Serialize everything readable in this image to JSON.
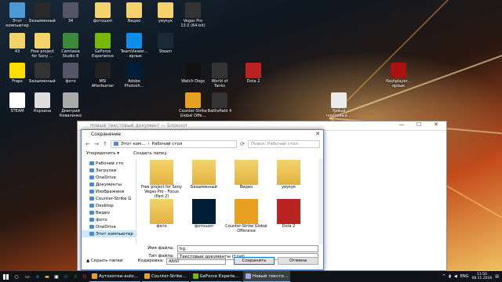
{
  "desktop": {
    "icons": [
      {
        "label": "Этот компьютер",
        "color": "#4a9ad8"
      },
      {
        "label": "Безымянный",
        "color": "#2a2a2a"
      },
      {
        "label": "34",
        "color": "#556"
      },
      {
        "label": "фотошоп",
        "color": "#f4d36b"
      },
      {
        "label": "Видео",
        "color": "#f4d36b"
      },
      {
        "label": "уеукук",
        "color": "#f4d36b"
      },
      {
        "label": "Vegas Pro 13.0 (64-bit)",
        "color": "#333"
      },
      {
        "label": "43",
        "color": "#f4d36b"
      },
      {
        "label": "Free project for Sony ...",
        "color": "#f4d36b"
      },
      {
        "label": "Camtasia Studio 8",
        "color": "#3a8a3a"
      },
      {
        "label": "GeForce Experience",
        "color": "#76b900"
      },
      {
        "label": "TeamViewer... - ярлык",
        "color": "#0e8ee9"
      },
      {
        "label": "Steam",
        "color": "#1b2838"
      },
      {
        "label": "Fraps",
        "color": "#ffdd00"
      },
      {
        "label": "Безымянный",
        "color": "#333"
      },
      {
        "label": "фото",
        "color": "#556"
      },
      {
        "label": "MSI Afterburner",
        "color": "#222"
      },
      {
        "label": "Adobe Photosh...",
        "color": "#001e36"
      },
      {
        "label": "Watch Dogs",
        "color": "#111"
      },
      {
        "label": "World of Tanks",
        "color": "#333"
      },
      {
        "label": "Dota 2",
        "color": "#b22"
      },
      {
        "label": "flashplayer... ярлык",
        "color": "#a11"
      },
      {
        "label": "STEAM",
        "color": "#fff"
      },
      {
        "label": "Корзина",
        "color": "#ddd"
      },
      {
        "label": "Дмитрий Коваленко",
        "color": "#aaa"
      },
      {
        "label": "Counter-Strike Global Offe...",
        "color": "#e8a020"
      },
      {
        "label": "Battlefield 4",
        "color": "#333"
      },
      {
        "label": "Новый текстовый ...",
        "color": "#eaeaea"
      }
    ]
  },
  "notepad": {
    "title": "Новый текстовый документ — Блокнот"
  },
  "dialog": {
    "title": "Сохранение",
    "close": "✕",
    "path": [
      "Этот ком...",
      "Рабочий стол"
    ],
    "search_placeholder": "Поиск: Рабочий стол",
    "toolbar": {
      "organize": "Упорядочить ▾",
      "new_folder": "Создать папку"
    },
    "tree": [
      {
        "label": "Рабочий сто",
        "sel": false
      },
      {
        "label": "Загрузки",
        "sel": false
      },
      {
        "label": "OneDrive",
        "sel": false
      },
      {
        "label": "Документы",
        "sel": false
      },
      {
        "label": "Изображени",
        "sel": false
      },
      {
        "label": "Counter-Strike G",
        "sel": false
      },
      {
        "label": "Desktop",
        "sel": false
      },
      {
        "label": "Видео",
        "sel": false
      },
      {
        "label": "фото",
        "sel": false
      },
      {
        "label": "OneDrive",
        "sel": false
      },
      {
        "label": "Этот компьютер",
        "sel": true
      }
    ],
    "files": [
      {
        "label": "Free project for Sony Vegas Pro - Focus (Part 2)",
        "kind": "folder"
      },
      {
        "label": "Безымянный",
        "kind": "folder"
      },
      {
        "label": "Видео",
        "kind": "folder"
      },
      {
        "label": "уеукук",
        "kind": "folder"
      },
      {
        "label": "фото",
        "kind": "folder"
      },
      {
        "label": "фотошоп",
        "kind": "ps"
      },
      {
        "label": "Counter-Strike Global Offensive",
        "kind": "csgo"
      },
      {
        "label": "Dota 2",
        "kind": "dota"
      }
    ],
    "filename_label": "Имя файла:",
    "filename_value": "hg.",
    "filetype_label": "Тип файла:",
    "filetype_value": "Текстовые документы (*.txt)",
    "hide_folders": "▲ Скрыть папки",
    "encoding_label": "Кодировка:",
    "encoding_value": "ANSI",
    "save": "Сохранить",
    "cancel": "Отмена"
  },
  "taskbar": {
    "apps": [
      {
        "label": "Аутохотки-auto...",
        "color": "#e8a020",
        "active": false
      },
      {
        "label": "Counter-Strike...",
        "color": "#e8a020",
        "active": false
      },
      {
        "label": "GeForce Experie...",
        "color": "#76b900",
        "active": false
      },
      {
        "label": "Новый тексто...",
        "color": "#9ad",
        "active": true
      }
    ],
    "lang": "ENG",
    "time": "11:50",
    "date": "08.11.2016"
  }
}
